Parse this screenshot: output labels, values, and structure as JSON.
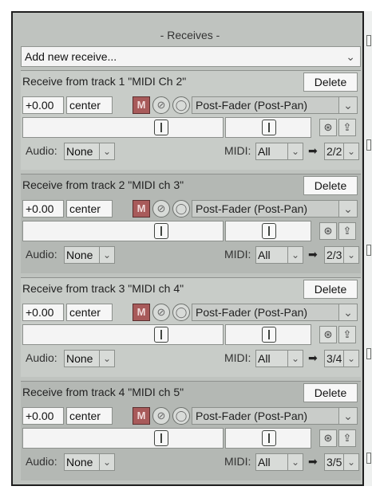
{
  "header": {
    "title": "- Receives -"
  },
  "add_receive": {
    "label": "Add new receive...",
    "chevron": "⌄"
  },
  "receives": [
    {
      "title": "Receive from track 1 \"MIDI Ch 2\"",
      "delete_label": "Delete",
      "volume": "+0.00",
      "pan": "center",
      "mute_glyph": "M",
      "phase_glyph": "⊘",
      "mono_glyph": "◯",
      "mode": "Post-Fader (Post-Pan)",
      "audio_label": "Audio:",
      "audio_value": "None",
      "midi_label": "MIDI:",
      "midi_value": "All",
      "arrow": "➡",
      "dest": "2/2"
    },
    {
      "title": "Receive from track 2 \"MIDI ch 3\"",
      "delete_label": "Delete",
      "volume": "+0.00",
      "pan": "center",
      "mute_glyph": "M",
      "phase_glyph": "⊘",
      "mono_glyph": "◯",
      "mode": "Post-Fader (Post-Pan)",
      "audio_label": "Audio:",
      "audio_value": "None",
      "midi_label": "MIDI:",
      "midi_value": "All",
      "arrow": "➡",
      "dest": "2/3"
    },
    {
      "title": "Receive from track 3 \"MIDI ch 4\"",
      "delete_label": "Delete",
      "volume": "+0.00",
      "pan": "center",
      "mute_glyph": "M",
      "phase_glyph": "⊘",
      "mono_glyph": "◯",
      "mode": "Post-Fader (Post-Pan)",
      "audio_label": "Audio:",
      "audio_value": "None",
      "midi_label": "MIDI:",
      "midi_value": "All",
      "arrow": "➡",
      "dest": "3/4"
    },
    {
      "title": "Receive from track 4 \"MIDI ch 5\"",
      "delete_label": "Delete",
      "volume": "+0.00",
      "pan": "center",
      "mute_glyph": "M",
      "phase_glyph": "⊘",
      "mono_glyph": "◯",
      "mode": "Post-Fader (Post-Pan)",
      "audio_label": "Audio:",
      "audio_value": "None",
      "midi_label": "MIDI:",
      "midi_value": "All",
      "arrow": "➡",
      "dest": "3/5"
    }
  ],
  "icons": {
    "chevron": "chevron-down-icon",
    "envelope": "envelope-icon",
    "route": "route-icon"
  },
  "colors": {
    "mute_active": "#a85a5a",
    "panel_bg": "#bfc3bf"
  }
}
